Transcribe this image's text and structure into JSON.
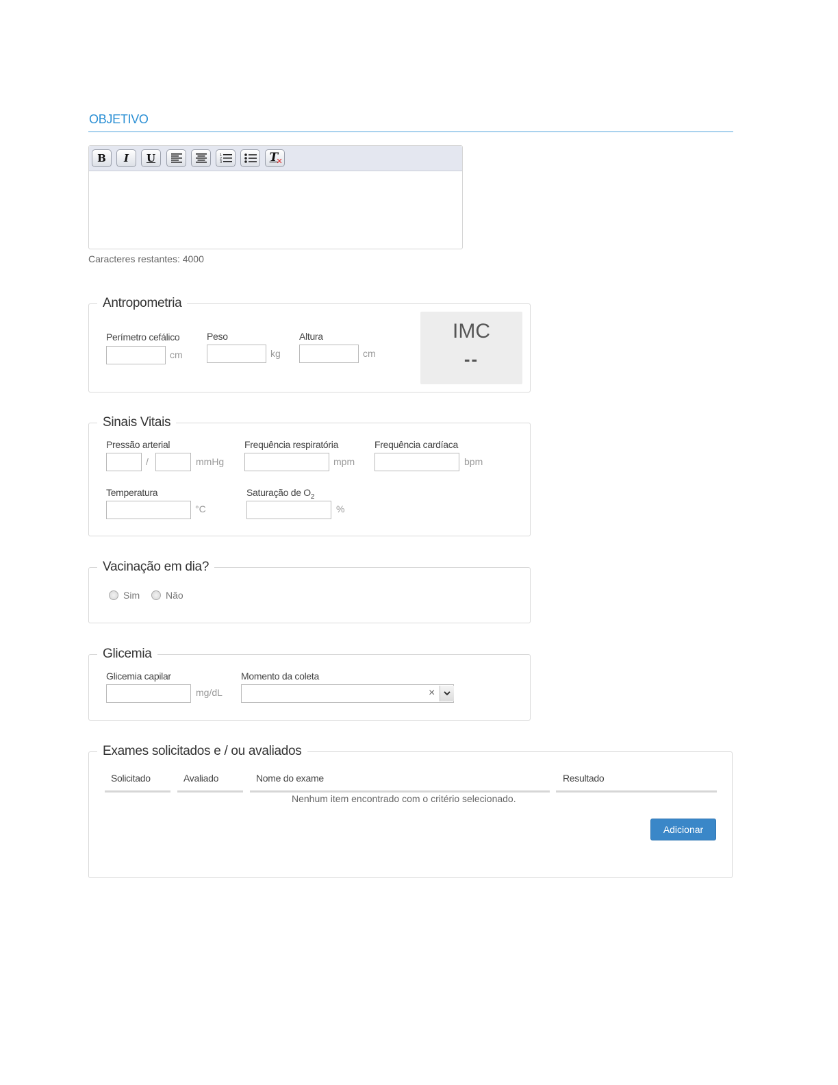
{
  "section": {
    "title": "OBJETIVO"
  },
  "editor": {
    "toolbar": [
      {
        "name": "bold-button",
        "icon": "bold-icon",
        "glyph": "B"
      },
      {
        "name": "italic-button",
        "icon": "italic-icon",
        "glyph": "I"
      },
      {
        "name": "underline-button",
        "icon": "underline-icon",
        "glyph": "U"
      },
      {
        "name": "align-left-button",
        "icon": "align-left-icon"
      },
      {
        "name": "align-center-button",
        "icon": "align-center-icon"
      },
      {
        "name": "ordered-list-button",
        "icon": "ordered-list-icon"
      },
      {
        "name": "unordered-list-button",
        "icon": "unordered-list-icon"
      },
      {
        "name": "clear-format-button",
        "icon": "clear-format-icon",
        "glyph": "T"
      }
    ],
    "char_count": "Caracteres restantes: 4000"
  },
  "antropometria": {
    "legend": "Antropometria",
    "perimetro_label": "Perímetro cefálico",
    "perimetro_unit": "cm",
    "peso_label": "Peso",
    "peso_unit": "kg",
    "altura_label": "Altura",
    "altura_unit": "cm",
    "imc_title": "IMC",
    "imc_value": "--"
  },
  "sinais_vitais": {
    "legend": "Sinais Vitais",
    "pressao_label": "Pressão arterial",
    "pressao_sep": "/",
    "pressao_unit": "mmHg",
    "freq_resp_label": "Frequência respiratória",
    "freq_resp_unit": "mpm",
    "freq_card_label": "Frequência cardíaca",
    "freq_card_unit": "bpm",
    "temp_label": "Temperatura",
    "temp_unit": "°C",
    "sat_label": "Saturação de O",
    "sat_sub": "2",
    "sat_unit": "%"
  },
  "vacinacao": {
    "legend": "Vacinação em dia?",
    "opt_sim": "Sim",
    "opt_nao": "Não"
  },
  "glicemia": {
    "legend": "Glicemia",
    "capilar_label": "Glicemia capilar",
    "capilar_unit": "mg/dL",
    "momento_label": "Momento da coleta",
    "clear_glyph": "×"
  },
  "exames": {
    "legend": "Exames solicitados e / ou avaliados",
    "columns": [
      "Solicitado",
      "Avaliado",
      "Nome do exame",
      "Resultado"
    ],
    "empty_message": "Nenhum item encontrado com o critério selecionado.",
    "add_button": "Adicionar"
  },
  "colors": {
    "accent": "#2a8fd4",
    "primary_button": "#3a87c8"
  }
}
